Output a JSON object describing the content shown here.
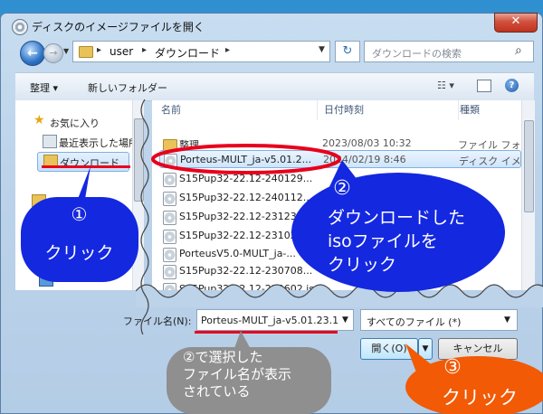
{
  "window": {
    "title": "ディスクのイメージファイルを開く",
    "close_glyph": "✕"
  },
  "address": {
    "segments": [
      "user",
      "ダウンロード"
    ],
    "sep": "▸",
    "back_glyph": "←",
    "forward_glyph": "→",
    "refresh_glyph": "↻"
  },
  "search": {
    "placeholder": "ダウンロードの検索",
    "icon": "search-icon"
  },
  "toolbar": {
    "organize": "整理 ▾",
    "new_folder": "新しいフォルダー",
    "view": "☷ ▾",
    "help": "?"
  },
  "nav": {
    "items": [
      {
        "label": "お気に入り",
        "icon": "star-icon"
      },
      {
        "label": "最近表示した場所",
        "icon": "recent-places-icon"
      },
      {
        "label": "ダウンロード",
        "icon": "downloads-folder-icon",
        "selected": true
      }
    ]
  },
  "columns": {
    "name": "名前",
    "date": "日付時刻",
    "type": "種類"
  },
  "files": [
    {
      "name": "整理",
      "date": "2023/08/03 10:32",
      "type": "ファイル フォ",
      "kind": "folder"
    },
    {
      "name": "Porteus-MULT_ja-v5.01.2...",
      "date": "2024/02/19 8:46",
      "type": "ディスク イメ",
      "kind": "iso",
      "selected": true
    },
    {
      "name": "S15Pup32-22.12-240129...",
      "date": "",
      "type": "",
      "kind": "iso"
    },
    {
      "name": "S15Pup32-22.12-240112...",
      "date": "",
      "type": "",
      "kind": "iso"
    },
    {
      "name": "S15Pup32-22.12-231231...",
      "date": "",
      "type": "",
      "kind": "iso"
    },
    {
      "name": "S15Pup32-22.12-231024...",
      "date": "",
      "type": "",
      "kind": "iso"
    },
    {
      "name": "PorteusV5.0-MULT_ja-...",
      "date": "",
      "type": "",
      "kind": "iso"
    },
    {
      "name": "S15Pup32-22.12-230708...",
      "date": "",
      "type": "",
      "kind": "iso"
    },
    {
      "name": "S15Pup32-22.12-230602.iso",
      "date": "",
      "type": "",
      "kind": "iso"
    }
  ],
  "bottom": {
    "filename_label": "ファイル名(N):",
    "filename_value": "Porteus-MULT_ja-v5.01.23.1",
    "filetype_value": "すべてのファイル (*)",
    "open_label": "開く(O)",
    "cancel_label": "キャンセル"
  },
  "annotations": {
    "a1_num": "①",
    "a1_text": "クリック",
    "a2_num": "②",
    "a2_l1": "ダウンロードした",
    "a2_l2": "isoファイルを",
    "a2_l3": "クリック",
    "a3_l1": "②で選択した",
    "a3_l2": "ファイル名が表示",
    "a3_l3": "されている",
    "a4_num": "③",
    "a4_text": "クリック"
  },
  "colors": {
    "blue_bubble": "#1428e0",
    "gray_bubble": "#8f8f8f",
    "orange_bubble": "#f25a05",
    "red_mark": "#e8001c"
  }
}
